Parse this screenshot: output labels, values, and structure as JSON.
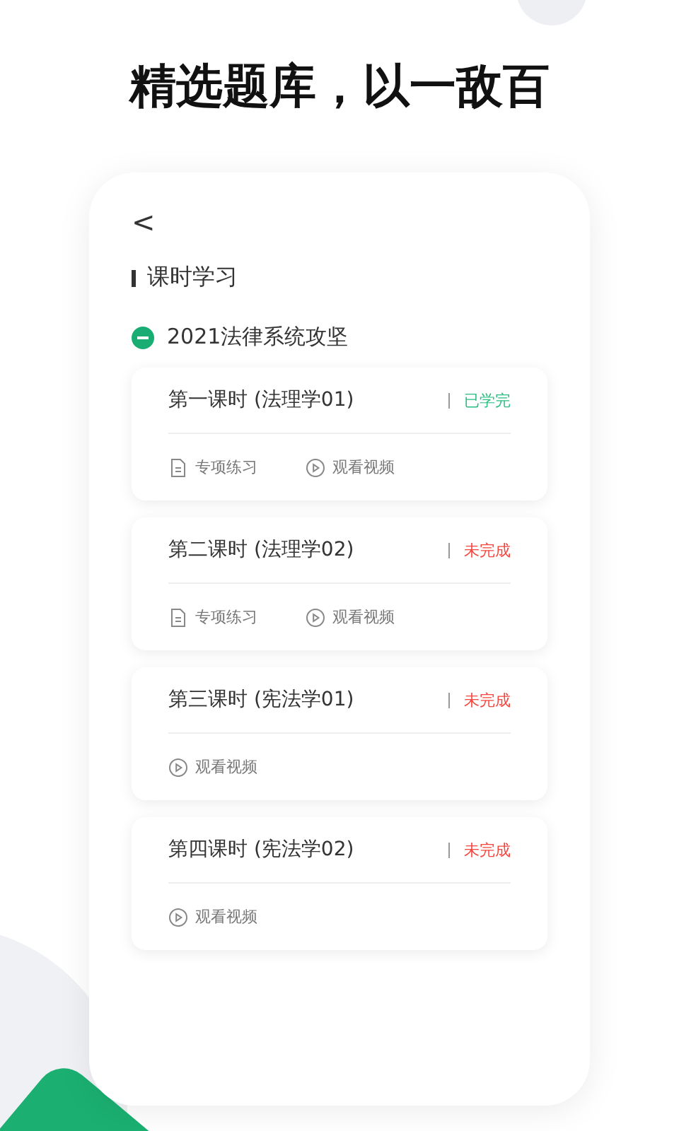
{
  "headline": "精选题库，以一敌百",
  "back": "<",
  "section_title": "课时学习",
  "course": {
    "title": "2021法律系统攻坚",
    "expanded": true
  },
  "lessons": [
    {
      "title": "第一课时 (法理学01)",
      "status": "已学完",
      "completed": true,
      "actions": [
        {
          "kind": "practice",
          "label": "专项练习"
        },
        {
          "kind": "video",
          "label": "观看视频"
        }
      ]
    },
    {
      "title": "第二课时 (法理学02)",
      "status": "未完成",
      "completed": false,
      "actions": [
        {
          "kind": "practice",
          "label": "专项练习"
        },
        {
          "kind": "video",
          "label": "观看视频"
        }
      ]
    },
    {
      "title": "第三课时 (宪法学01)",
      "status": "未完成",
      "completed": false,
      "actions": [
        {
          "kind": "video",
          "label": "观看视频"
        }
      ]
    },
    {
      "title": "第四课时 (宪法学02)",
      "status": "未完成",
      "completed": false,
      "actions": [
        {
          "kind": "video",
          "label": "观看视频"
        }
      ]
    }
  ]
}
